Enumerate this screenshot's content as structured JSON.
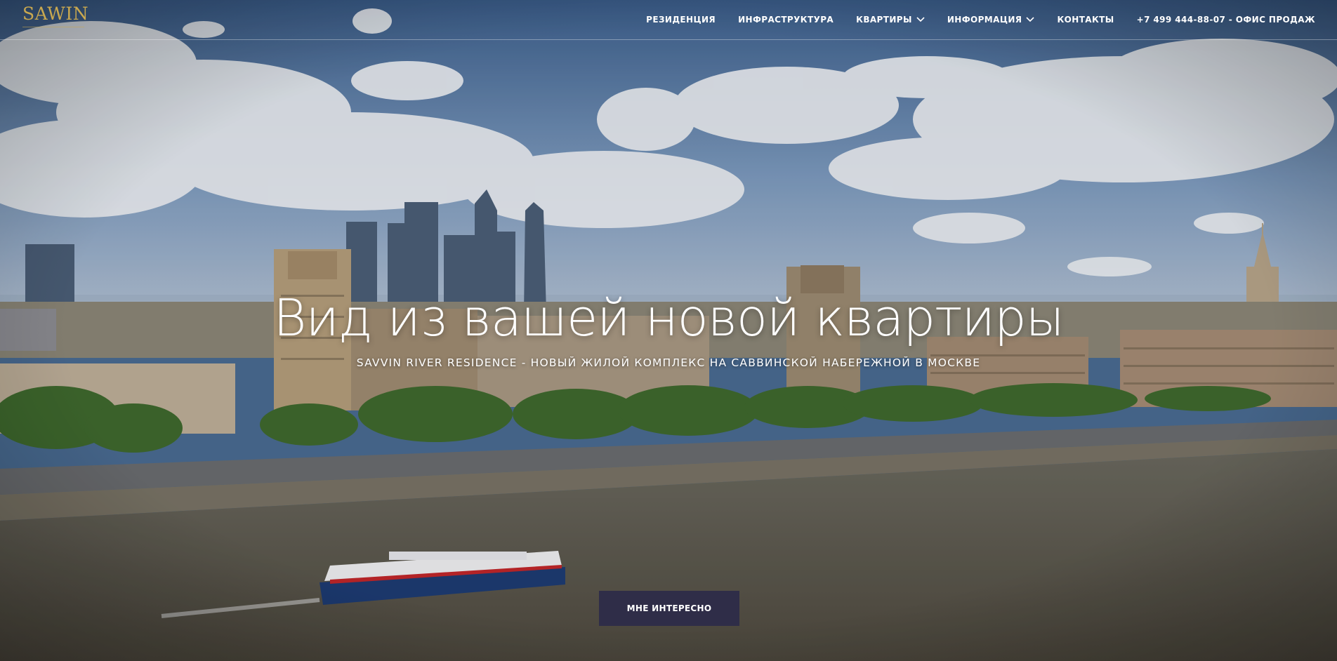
{
  "brand": {
    "logo_text": "SAWIN"
  },
  "nav": {
    "items": [
      {
        "label": "РЕЗИДЕНЦИЯ"
      },
      {
        "label": "ИНФРАСТРУКТУРА"
      },
      {
        "label": "КВАРТИРЫ"
      },
      {
        "label": "ИНФОРМАЦИЯ"
      },
      {
        "label": "КОНТАКТЫ"
      }
    ],
    "phone": "+7 499 444-88-07 - ОФИС ПРОДАЖ"
  },
  "hero": {
    "title": "Вид из вашей новой квартиры",
    "subtitle": "SAVVIN RIVER RESIDENCE - НОВЫЙ ЖИЛОЙ КОМПЛЕКС НА САВВИНСКОЙ НАБЕРЕЖНОЙ В МОСКВЕ",
    "cta_label": "МНЕ ИНТЕРЕСНО"
  },
  "colors": {
    "logo": "#c9a84f",
    "cta_background": "#2f2d48",
    "sky": "#4a6c93",
    "river": "#5a5548"
  }
}
